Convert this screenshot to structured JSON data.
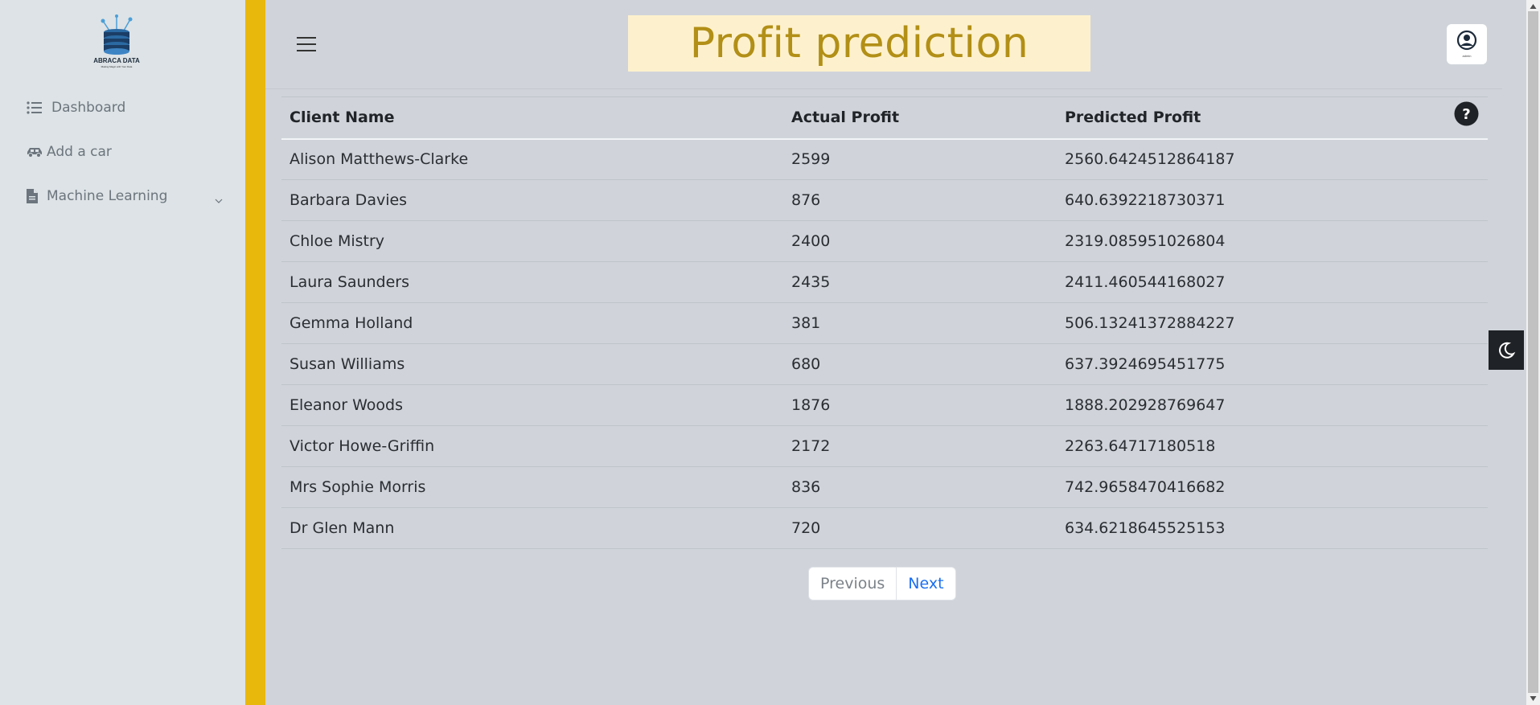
{
  "brand": {
    "logo_text": "ABRACA DATA",
    "logo_tagline": "Making Magic with Your Data"
  },
  "sidebar": {
    "items": [
      {
        "label": "Dashboard",
        "icon": "list-icon"
      },
      {
        "label": "Add a car",
        "icon": "car-icon"
      },
      {
        "label": "Machine Learning",
        "icon": "document-icon",
        "has_submenu": true
      }
    ]
  },
  "header": {
    "title": "Profit prediction",
    "user_caption": "admin"
  },
  "table": {
    "columns": [
      "Client Name",
      "Actual Profit",
      "Predicted Profit"
    ],
    "rows": [
      [
        "Alison Matthews-Clarke",
        "2599",
        "2560.6424512864187"
      ],
      [
        "Barbara Davies",
        "876",
        "640.6392218730371"
      ],
      [
        "Chloe Mistry",
        "2400",
        "2319.085951026804"
      ],
      [
        "Laura Saunders",
        "2435",
        "2411.460544168027"
      ],
      [
        "Gemma Holland",
        "381",
        "506.13241372884227"
      ],
      [
        "Susan Williams",
        "680",
        "637.3924695451775"
      ],
      [
        "Eleanor Woods",
        "1876",
        "1888.202928769647"
      ],
      [
        "Victor Howe-Griffin",
        "2172",
        "2263.64717180518"
      ],
      [
        "Mrs Sophie Morris",
        "836",
        "742.9658470416682"
      ],
      [
        "Dr Glen Mann",
        "720",
        "634.6218645525153"
      ]
    ]
  },
  "pagination": {
    "previous_label": "Previous",
    "next_label": "Next"
  },
  "colors": {
    "accent": "#e9b80d",
    "title_text": "#b28f16",
    "title_bg": "#fdf1cd",
    "link": "#1a6ef0"
  }
}
